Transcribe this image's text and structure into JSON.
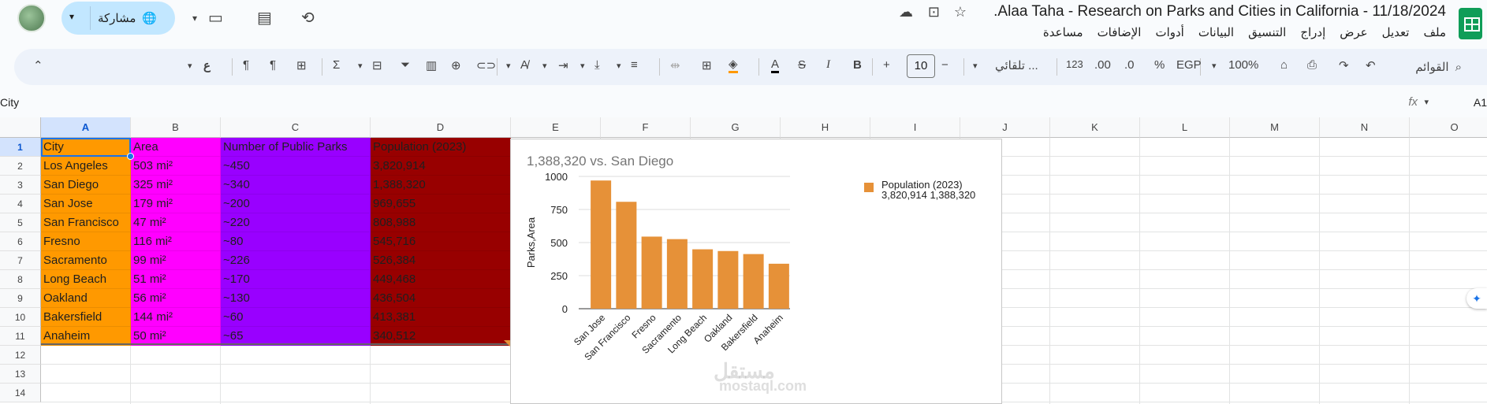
{
  "document": {
    "title": ".Alaa Taha - Research on Parks and Cities in California - 11/18/2024"
  },
  "menu": [
    "ملف",
    "تعديل",
    "عرض",
    "إدراج",
    "التنسيق",
    "البيانات",
    "أدوات",
    "الإضافات",
    "مساعدة"
  ],
  "share": {
    "label": "مشاركة"
  },
  "toolbar": {
    "menus_search": "القوائم",
    "zoom": "100%",
    "currency": "EGP",
    "percent": "%",
    "dec_decrease": ".0",
    "dec_increase": ".00",
    "number_format": "123",
    "font": "تلقائي ...",
    "font_size": "10",
    "bold": "B",
    "italic": "I",
    "text_color": "A"
  },
  "formula_bar": {
    "name_box": "A1",
    "fx": "fx",
    "value": "City"
  },
  "columns": [
    "A",
    "B",
    "C",
    "D",
    "E",
    "F",
    "G",
    "H",
    "I",
    "J",
    "K",
    "L",
    "M",
    "N",
    "O"
  ],
  "rows": [
    "1",
    "2",
    "3",
    "4",
    "5",
    "6",
    "7",
    "8",
    "9",
    "10",
    "11",
    "12",
    "13",
    "14"
  ],
  "table": {
    "headers": [
      "City",
      "Area",
      "Number of Public Parks",
      "Population (2023)"
    ],
    "rows": [
      [
        "Los Angeles",
        "503 mi²",
        "~450",
        "3,820,914"
      ],
      [
        "San Diego",
        "325 mi²",
        "~340",
        "1,388,320"
      ],
      [
        "San Jose",
        "179 mi²",
        "~200",
        "969,655"
      ],
      [
        "San Francisco",
        "47 mi²",
        "~220",
        "808,988"
      ],
      [
        "Fresno",
        "116 mi²",
        "~80",
        "545,716"
      ],
      [
        "Sacramento",
        "99 mi²",
        "~226",
        "526,384"
      ],
      [
        "Long Beach",
        "51 mi²",
        "~170",
        "449,468"
      ],
      [
        "Oakland",
        "56 mi²",
        "~130",
        "436,504"
      ],
      [
        "Bakersfield",
        "144 mi²",
        "~60",
        "413,381"
      ],
      [
        "Anaheim",
        "50 mi²",
        "~65",
        "340,512"
      ]
    ]
  },
  "colors": {
    "col_a": "#ff9900",
    "col_b": "#ff00ff",
    "col_c": "#9900ff",
    "col_d": "#980000",
    "bar": "#e69138",
    "selection": "#1a73e8"
  },
  "chart_data": {
    "type": "bar",
    "title": "1,388,320 vs. San Diego",
    "ylabel": "Parks,Area",
    "xlabel": "",
    "categories": [
      "San Jose",
      "San Francisco",
      "Fresno",
      "Sacramento",
      "Long Beach",
      "Oakland",
      "Bakersfield",
      "Anaheim"
    ],
    "series": [
      {
        "name": "Population (2023) 3,820,914 1,388,320",
        "values": [
          969,
          808,
          545,
          526,
          449,
          436,
          413,
          340
        ]
      }
    ],
    "yticks": [
      "0",
      "250",
      "500",
      "750",
      "1000"
    ],
    "ylim": [
      0,
      1000
    ],
    "legend": "top-right",
    "grid": true
  },
  "legend": {
    "line1": "Population (2023)",
    "line2": "3,820,914 1,388,320"
  },
  "watermark": {
    "arabic": "مستقل",
    "latin": "mostaql.com"
  }
}
